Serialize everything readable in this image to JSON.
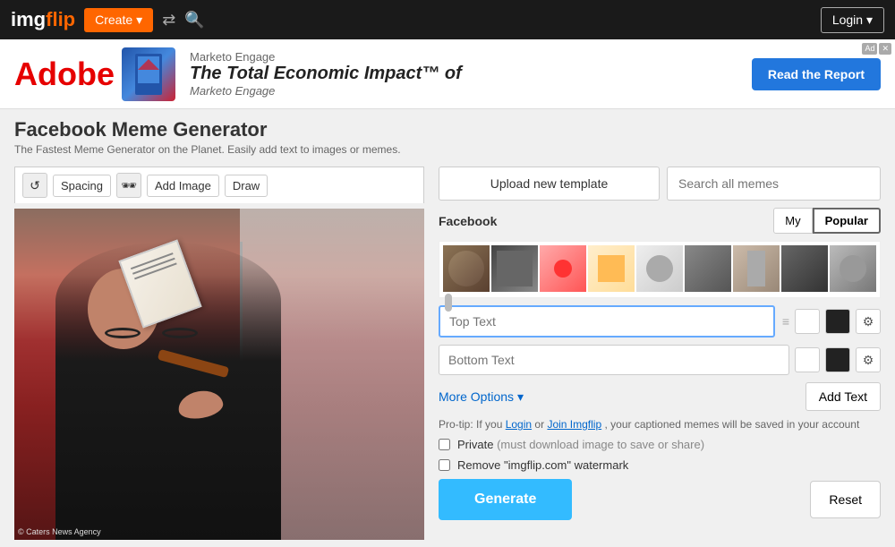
{
  "navbar": {
    "logo_img": "imgflip",
    "logo_color": "flip",
    "create_label": "Create",
    "login_label": "Login"
  },
  "ad": {
    "brand": "Marketo Engage",
    "headline": "The Total Economic Impact™ of",
    "headline2": "Marketo Engage",
    "read_btn": "Read the Report",
    "badge": "Ad",
    "close": "✕",
    "adobe_logo": "Adobe"
  },
  "page": {
    "title": "Facebook Meme Generator",
    "subtitle": "The Fastest Meme Generator on the Planet. Easily add text to images or memes."
  },
  "toolbar": {
    "refresh_icon": "↺",
    "spacing_label": "Spacing",
    "sunglasses_icon": "🕶",
    "add_image_label": "Add Image",
    "draw_label": "Draw"
  },
  "photo_caption": "© Caters News Agency",
  "right": {
    "upload_btn": "Upload new template",
    "search_placeholder": "Search all memes",
    "facebook_label": "Facebook",
    "tab_my": "My",
    "tab_popular": "Popular"
  },
  "text_inputs": {
    "top_placeholder": "Top Text",
    "bottom_placeholder": "Bottom Text"
  },
  "options": {
    "more_options": "More Options",
    "add_text": "Add Text"
  },
  "protip": {
    "text_before": "Pro-tip: If you ",
    "link1": "Login",
    "text_middle": " or ",
    "link2": "Join Imgflip",
    "text_after": ", your captioned memes will be saved in your account"
  },
  "checkboxes": {
    "private_label": "Private",
    "private_sub": "(must download image to save or share)",
    "watermark_label": "Remove \"imgflip.com\" watermark"
  },
  "buttons": {
    "generate": "Generate",
    "reset": "Reset"
  }
}
